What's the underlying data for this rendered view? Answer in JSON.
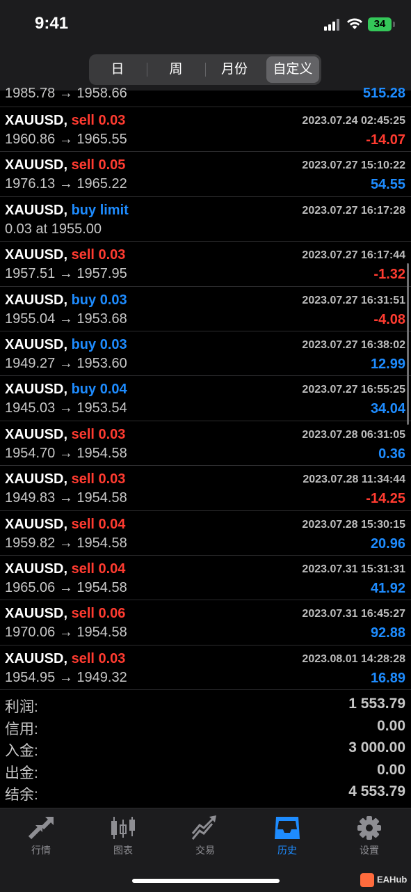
{
  "status": {
    "time": "9:41",
    "battery": "34"
  },
  "period_tabs": [
    {
      "label": "日",
      "selected": false
    },
    {
      "label": "周",
      "selected": false
    },
    {
      "label": "月份",
      "selected": false
    },
    {
      "label": "自定义",
      "selected": true
    }
  ],
  "partial_row": {
    "prices": "1985.78 → 1958.66",
    "profit": "515.28"
  },
  "trades": [
    {
      "symbol": "XAUUSD,",
      "type": "sell 0.03",
      "side": "sell",
      "time": "2023.07.24 02:45:25",
      "prices": "1960.86 → 1965.55",
      "profit": "-14.07"
    },
    {
      "symbol": "XAUUSD,",
      "type": "sell 0.05",
      "side": "sell",
      "time": "2023.07.27 15:10:22",
      "prices": "1976.13 → 1965.22",
      "profit": "54.55"
    },
    {
      "symbol": "XAUUSD,",
      "type": "buy limit",
      "side": "buy",
      "time": "2023.07.27 16:17:28",
      "prices": "0.03 at 1955.00",
      "profit": ""
    },
    {
      "symbol": "XAUUSD,",
      "type": "sell 0.03",
      "side": "sell",
      "time": "2023.07.27 16:17:44",
      "prices": "1957.51 → 1957.95",
      "profit": "-1.32"
    },
    {
      "symbol": "XAUUSD,",
      "type": "buy 0.03",
      "side": "buy",
      "time": "2023.07.27 16:31:51",
      "prices": "1955.04 → 1953.68",
      "profit": "-4.08"
    },
    {
      "symbol": "XAUUSD,",
      "type": "buy 0.03",
      "side": "buy",
      "time": "2023.07.27 16:38:02",
      "prices": "1949.27 → 1953.60",
      "profit": "12.99"
    },
    {
      "symbol": "XAUUSD,",
      "type": "buy 0.04",
      "side": "buy",
      "time": "2023.07.27 16:55:25",
      "prices": "1945.03 → 1953.54",
      "profit": "34.04"
    },
    {
      "symbol": "XAUUSD,",
      "type": "sell 0.03",
      "side": "sell",
      "time": "2023.07.28 06:31:05",
      "prices": "1954.70 → 1954.58",
      "profit": "0.36"
    },
    {
      "symbol": "XAUUSD,",
      "type": "sell 0.03",
      "side": "sell",
      "time": "2023.07.28 11:34:44",
      "prices": "1949.83 → 1954.58",
      "profit": "-14.25"
    },
    {
      "symbol": "XAUUSD,",
      "type": "sell 0.04",
      "side": "sell",
      "time": "2023.07.28 15:30:15",
      "prices": "1959.82 → 1954.58",
      "profit": "20.96"
    },
    {
      "symbol": "XAUUSD,",
      "type": "sell 0.04",
      "side": "sell",
      "time": "2023.07.31 15:31:31",
      "prices": "1965.06 → 1954.58",
      "profit": "41.92"
    },
    {
      "symbol": "XAUUSD,",
      "type": "sell 0.06",
      "side": "sell",
      "time": "2023.07.31 16:45:27",
      "prices": "1970.06 → 1954.58",
      "profit": "92.88"
    },
    {
      "symbol": "XAUUSD,",
      "type": "sell 0.03",
      "side": "sell",
      "time": "2023.08.01 14:28:28",
      "prices": "1954.95 → 1949.32",
      "profit": "16.89"
    }
  ],
  "summary": [
    {
      "label": "利润:",
      "value": "1 553.79"
    },
    {
      "label": "信用:",
      "value": "0.00"
    },
    {
      "label": "入金:",
      "value": "3 000.00"
    },
    {
      "label": "出金:",
      "value": "0.00"
    },
    {
      "label": "结余:",
      "value": "4 553.79"
    }
  ],
  "tabbar": [
    {
      "label": "行情",
      "icon": "quotes-arrows-icon",
      "active": false
    },
    {
      "label": "图表",
      "icon": "candlestick-chart-icon",
      "active": false
    },
    {
      "label": "交易",
      "icon": "trade-chart-icon",
      "active": false
    },
    {
      "label": "历史",
      "icon": "history-tray-icon",
      "active": true
    },
    {
      "label": "设置",
      "icon": "gear-icon",
      "active": false
    }
  ],
  "watermark": "EAHub",
  "colors": {
    "sell": "#ff3b30",
    "buy": "#1e8cff",
    "negative": "#ff3b30",
    "positive": "#1e8cff",
    "active_tab": "#1e8cff"
  }
}
